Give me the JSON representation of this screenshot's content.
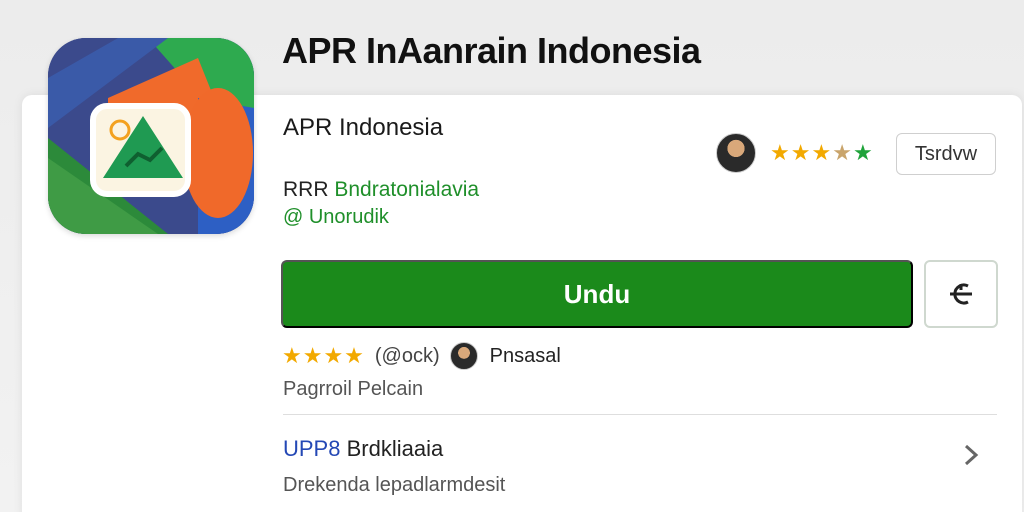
{
  "header": {
    "title": "APR InAanrain Indonesia"
  },
  "app": {
    "name": "APR Indonesia",
    "developer_prefix": "RRR",
    "developer_name": "Bndratonialavia",
    "sub_label": "@ Unorudik"
  },
  "rating_top": {
    "stars": 4.5
  },
  "review_button": {
    "label": "Tsrdvw"
  },
  "install": {
    "label": "Undu"
  },
  "share": {
    "icon": "share-icon"
  },
  "rating_row": {
    "stars": 4,
    "count_text": "(@ock)",
    "reviewer_name": "Pnsasal"
  },
  "category": "Pagrroil Pelcain",
  "section": {
    "title_prefix": "UPP8",
    "title_rest": "Brdkliaaia",
    "subtitle": "Drekenda lepadlarmdesit"
  },
  "colors": {
    "install_green": "#1b8a1b",
    "developer_green": "#1f8f2a",
    "section_blue": "#2448b5",
    "star_gold": "#f2a900"
  }
}
